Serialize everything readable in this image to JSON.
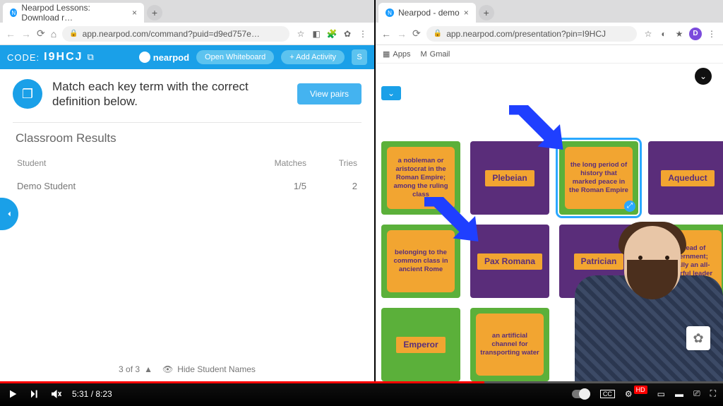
{
  "left_window": {
    "tab_title": "Nearpod Lessons: Download r…",
    "url": "app.nearpod.com/command?puid=d9ed757e…",
    "header": {
      "code_label": "CODE:",
      "code_value": "I9HCJ",
      "brand": "nearpod",
      "open_whiteboard": "Open Whiteboard",
      "add_activity": "+ Add Activity"
    },
    "prompt": "Match each key term with the correct definition below.",
    "view_pairs": "View pairs",
    "results_title": "Classroom Results",
    "columns": {
      "student": "Student",
      "matches": "Matches",
      "tries": "Tries"
    },
    "rows": [
      {
        "student": "Demo Student",
        "matches": "1/5",
        "tries": "2"
      }
    ],
    "footer": {
      "counter": "3 of 3",
      "hide": "Hide Student Names"
    }
  },
  "right_window": {
    "tab_title": "Nearpod - demo",
    "url": "app.nearpod.com/presentation?pin=I9HCJ",
    "bookmarks": {
      "apps": "Apps",
      "gmail": "Gmail"
    },
    "cards": [
      {
        "kind": "def",
        "text": "a nobleman or aristocrat in the Roman Empire; among the ruling class"
      },
      {
        "kind": "term",
        "text": "Plebeian"
      },
      {
        "kind": "def",
        "text": "the long period of history that marked peace in the Roman Empire",
        "selected": true
      },
      {
        "kind": "term",
        "text": "Aqueduct"
      },
      {
        "kind": "def",
        "text": "belonging to the common class in ancient Rome"
      },
      {
        "kind": "term",
        "text": "Pax Romana"
      },
      {
        "kind": "term",
        "text": "Patrician"
      },
      {
        "kind": "def",
        "text": "the head of government; usually an all-powerful leader"
      },
      {
        "kind": "term-green",
        "text": "Emperor"
      },
      {
        "kind": "def",
        "text": "an artificial channel for transporting water"
      }
    ]
  },
  "player": {
    "current": "5:31",
    "total": "8:23",
    "progress_pct": 67
  }
}
